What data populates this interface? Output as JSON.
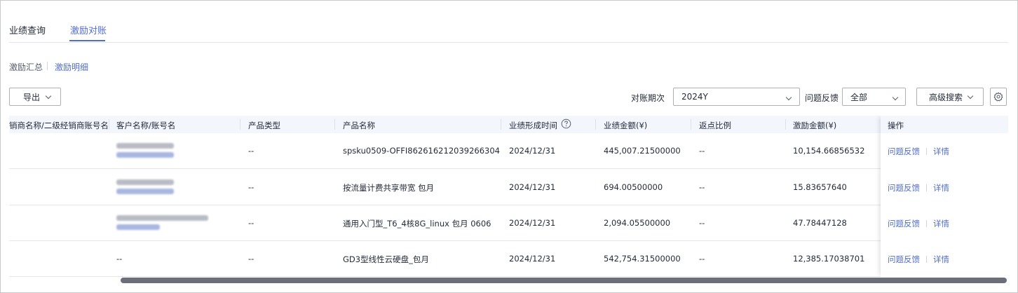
{
  "tabs": [
    {
      "label": "业绩查询",
      "active": false
    },
    {
      "label": "激励对账",
      "active": true
    }
  ],
  "subnav": {
    "summary": "激励汇总",
    "detail": "激励明细"
  },
  "toolbar": {
    "export_label": "导出",
    "period_label": "对账期次",
    "period_value": "2024Y",
    "feedback_label": "问题反馈",
    "feedback_value": "全部",
    "advanced_search": "高级搜索",
    "settings_icon": "gear-icon"
  },
  "table": {
    "columns": [
      "销商名称/二级经销商账号名",
      "客户名称/账号名",
      "产品类型",
      "产品名称",
      "业绩形成时间",
      "业绩金额(¥)",
      "返点比例",
      "激励金额(¥)",
      "操作"
    ],
    "help_icon": "question-circle-icon",
    "rows": [
      {
        "product_type": "--",
        "product_name": "spsku0509-OFFI862616212039266304",
        "time": "2024/12/31",
        "amount": "445,007.21500000",
        "ratio": "--",
        "incentive": "10,154.66856532",
        "op_feedback": "问题反馈",
        "op_detail": "详情"
      },
      {
        "product_type": "--",
        "product_name": "按流量计费共享带宽 包月",
        "time": "2024/12/31",
        "amount": "694.00500000",
        "ratio": "--",
        "incentive": "15.83657640",
        "op_feedback": "问题反馈",
        "op_detail": "详情"
      },
      {
        "product_type": "--",
        "product_name": "通用入门型_T6_4核8G_linux 包月 0606",
        "time": "2024/12/31",
        "amount": "2,094.05500000",
        "ratio": "--",
        "incentive": "47.78447128",
        "op_feedback": "问题反馈",
        "op_detail": "详情"
      },
      {
        "customer": "--",
        "product_type": "--",
        "product_name": "GD3型线性云硬盘_包月",
        "time": "2024/12/31",
        "amount": "542,754.31500000",
        "ratio": "--",
        "incentive": "12,385.17038701",
        "op_feedback": "问题反馈",
        "op_detail": "详情"
      }
    ]
  }
}
